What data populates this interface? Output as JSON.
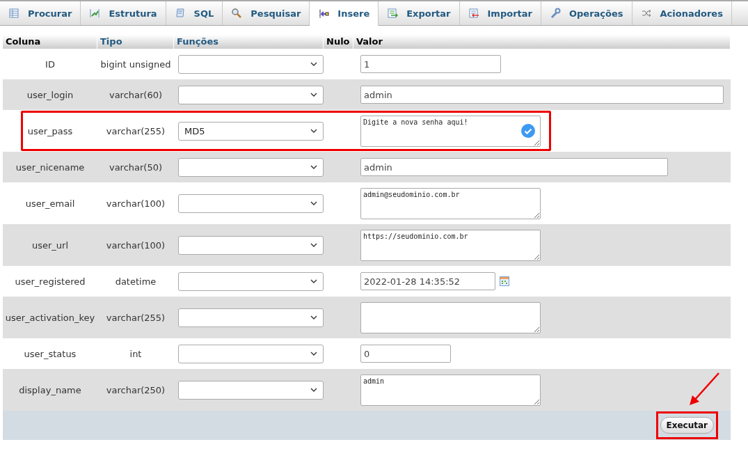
{
  "tabs": [
    {
      "label": "Procurar",
      "selected": false
    },
    {
      "label": "Estrutura",
      "selected": false
    },
    {
      "label": "SQL",
      "selected": false
    },
    {
      "label": "Pesquisar",
      "selected": false
    },
    {
      "label": "Insere",
      "selected": true
    },
    {
      "label": "Exportar",
      "selected": false
    },
    {
      "label": "Importar",
      "selected": false
    },
    {
      "label": "Operações",
      "selected": false
    },
    {
      "label": "Acionadores",
      "selected": false
    }
  ],
  "table": {
    "columns": [
      "Coluna",
      "Tipo",
      "Funções",
      "Nulo",
      "Valor"
    ],
    "rows": [
      {
        "column": "ID",
        "type": "bigint unsigned",
        "kind": "input",
        "value": "1",
        "highlighted": false
      },
      {
        "column": "user_login",
        "type": "varchar(60)",
        "kind": "input",
        "value": "admin",
        "highlighted": false
      },
      {
        "column": "user_pass",
        "type": "varchar(255)",
        "function": "MD5",
        "kind": "textarea",
        "value": "Digite a nova senha aqui!",
        "verified": true,
        "highlighted": true
      },
      {
        "column": "user_nicename",
        "type": "varchar(50)",
        "kind": "input",
        "value": "admin",
        "highlighted": false
      },
      {
        "column": "user_email",
        "type": "varchar(100)",
        "kind": "textarea",
        "value": "admin@seudominio.com.br",
        "highlighted": false
      },
      {
        "column": "user_url",
        "type": "varchar(100)",
        "kind": "textarea",
        "value": "https://seudominio.com.br",
        "highlighted": false
      },
      {
        "column": "user_registered",
        "type": "datetime",
        "kind": "date",
        "value": "2022-01-28 14:35:52",
        "highlighted": false
      },
      {
        "column": "user_activation_key",
        "type": "varchar(255)",
        "kind": "textarea",
        "highlighted": false
      },
      {
        "column": "user_status",
        "type": "int",
        "kind": "input",
        "value": "0",
        "highlighted": false
      },
      {
        "column": "display_name",
        "type": "varchar(250)",
        "kind": "textarea",
        "value": "admin",
        "highlighted": false
      }
    ]
  },
  "submit": {
    "label": "Executar",
    "highlighted": true
  }
}
